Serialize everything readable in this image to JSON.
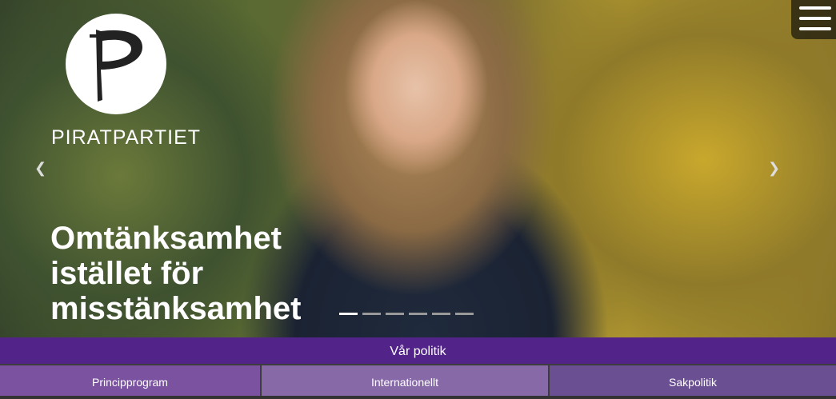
{
  "brand": {
    "name": "PIRATPARTIET"
  },
  "hero": {
    "headline": [
      "Omtänksamhet",
      "istället för",
      "misstänksamhet"
    ],
    "slide_count": 6,
    "active_slide": 1,
    "prev_icon": "chevron-left-icon",
    "next_icon": "chevron-right-icon"
  },
  "menu": {
    "icon": "hamburger-menu-icon"
  },
  "politik": {
    "title": "Vår politik",
    "items": [
      {
        "label": "Principprogram",
        "color": "#7a52a0"
      },
      {
        "label": "Internationellt",
        "color": "#8769a8"
      },
      {
        "label": "Sakpolitik",
        "color": "#6a4f93"
      }
    ]
  },
  "colors": {
    "purple": "#52248a"
  }
}
